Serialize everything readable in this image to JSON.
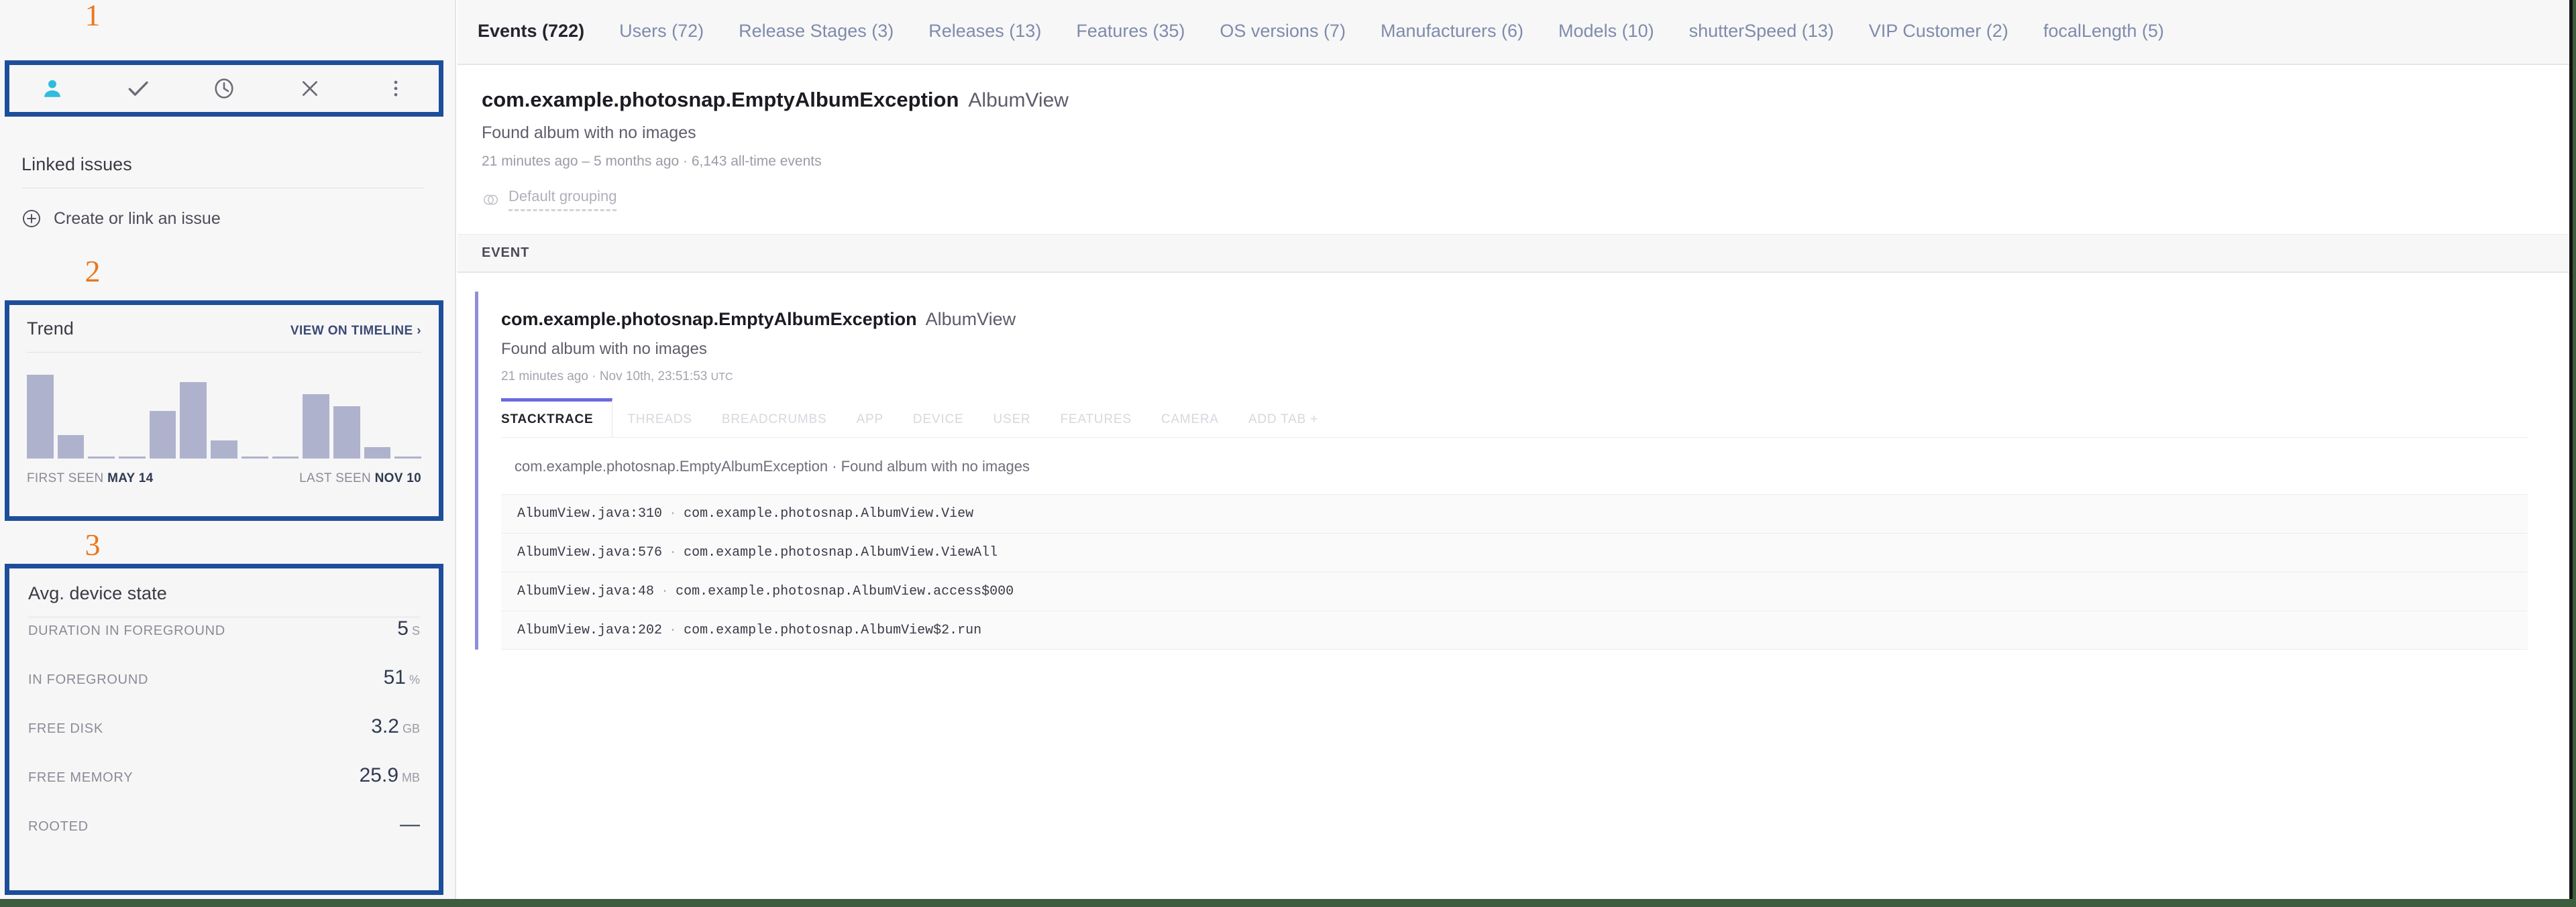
{
  "left_panel": {
    "toolbar": {
      "buttons": [
        {
          "name": "assign-user",
          "icon": "person-icon",
          "color": "#30bcdc",
          "active": true
        },
        {
          "name": "mark-fixed",
          "icon": "check-icon",
          "color": "#6b6b78",
          "active": false
        },
        {
          "name": "snooze",
          "icon": "clock-icon",
          "color": "#6b6b78",
          "active": false
        },
        {
          "name": "ignore",
          "icon": "x-icon",
          "color": "#6b6b78",
          "active": false
        },
        {
          "name": "more-options",
          "icon": "kebab-menu-icon",
          "color": "#6b6b78",
          "active": false
        }
      ]
    },
    "linked_issues": {
      "title": "Linked issues",
      "create_label": "Create or link an issue",
      "create_icon": "plus-circle-icon"
    },
    "trend": {
      "title": "Trend",
      "link_label": "VIEW ON TIMELINE ›",
      "first_seen_label": "FIRST SEEN",
      "first_seen_value": "MAY 14",
      "last_seen_label": "LAST SEEN",
      "last_seen_value": "NOV 10"
    },
    "device_state": {
      "title": "Avg. device state",
      "metrics": [
        {
          "label": "DURATION IN FOREGROUND",
          "value": "5",
          "unit": "S"
        },
        {
          "label": "IN FOREGROUND",
          "value": "51",
          "unit": "%"
        },
        {
          "label": "FREE DISK",
          "value": "3.2",
          "unit": "GB"
        },
        {
          "label": "FREE MEMORY",
          "value": "25.9",
          "unit": "MB"
        },
        {
          "label": "ROOTED",
          "value": "—",
          "unit": ""
        }
      ]
    }
  },
  "annotations": [
    {
      "number": "1",
      "target": "toolbar"
    },
    {
      "number": "2",
      "target": "trend-card"
    },
    {
      "number": "3",
      "target": "device-state-card"
    }
  ],
  "main": {
    "tabs": [
      {
        "label": "Events (722)",
        "active": true
      },
      {
        "label": "Users (72)",
        "active": false
      },
      {
        "label": "Release Stages (3)",
        "active": false
      },
      {
        "label": "Releases (13)",
        "active": false
      },
      {
        "label": "Features (35)",
        "active": false
      },
      {
        "label": "OS versions (7)",
        "active": false
      },
      {
        "label": "Manufacturers (6)",
        "active": false
      },
      {
        "label": "Models (10)",
        "active": false
      },
      {
        "label": "shutterSpeed (13)",
        "active": false
      },
      {
        "label": "VIP Customer (2)",
        "active": false
      },
      {
        "label": "focalLength (5)",
        "active": false
      }
    ],
    "error_header": {
      "title": "com.example.photosnap.EmptyAlbumException",
      "context": "AlbumView",
      "message": "Found album with no images",
      "meta": "21 minutes ago – 5 months ago · 6,143 all-time events",
      "grouping_label": "Default grouping",
      "grouping_icon": "venn-circles-icon"
    },
    "event_strip_label": "EVENT",
    "event": {
      "title": "com.example.photosnap.EmptyAlbumException",
      "context": "AlbumView",
      "message": "Found album with no images",
      "relative_time": "21 minutes ago",
      "separator": "·",
      "timestamp": "Nov 10th, 23:51:53",
      "timezone": "UTC",
      "sub_tabs": [
        {
          "label": "STACKTRACE",
          "active": true
        },
        {
          "label": "THREADS",
          "active": false
        },
        {
          "label": "BREADCRUMBS",
          "active": false
        },
        {
          "label": "APP",
          "active": false
        },
        {
          "label": "DEVICE",
          "active": false
        },
        {
          "label": "USER",
          "active": false
        },
        {
          "label": "FEATURES",
          "active": false
        },
        {
          "label": "CAMERA",
          "active": false
        },
        {
          "label": "ADD TAB +",
          "active": false
        }
      ],
      "trace_header": "com.example.photosnap.EmptyAlbumException · Found album with no images",
      "trace_rows": [
        {
          "location": "AlbumView.java:310",
          "method": "com.example.photosnap.AlbumView.View"
        },
        {
          "location": "AlbumView.java:576",
          "method": "com.example.photosnap.AlbumView.ViewAll"
        },
        {
          "location": "AlbumView.java:48",
          "method": "com.example.photosnap.AlbumView.access$000"
        },
        {
          "location": "AlbumView.java:202",
          "method": "com.example.photosnap.AlbumView$2.run"
        }
      ]
    }
  },
  "chart_data": {
    "type": "bar",
    "title": "Trend",
    "categories": [
      "1",
      "2",
      "3",
      "4",
      "5",
      "6",
      "7",
      "8",
      "9",
      "10",
      "11",
      "12",
      "13"
    ],
    "values": [
      96,
      27,
      2,
      2,
      55,
      88,
      21,
      2,
      2,
      74,
      60,
      13,
      2
    ],
    "xlabel": "",
    "ylabel": "",
    "ylim": [
      0,
      100
    ],
    "grid": false,
    "legend": "none",
    "bar_color": "#aeb2cc",
    "annotations": [
      "FIRST SEEN MAY 14",
      "LAST SEEN NOV 10"
    ]
  },
  "colors": {
    "annotation_box": "#1d4e9a",
    "annotation_number": "#e8781f",
    "accent_cyan": "#30bcdc",
    "event_accent": "#8f8fd8",
    "tab_inactive": "#7f8bab",
    "page_edge": "#3e5d3e"
  }
}
